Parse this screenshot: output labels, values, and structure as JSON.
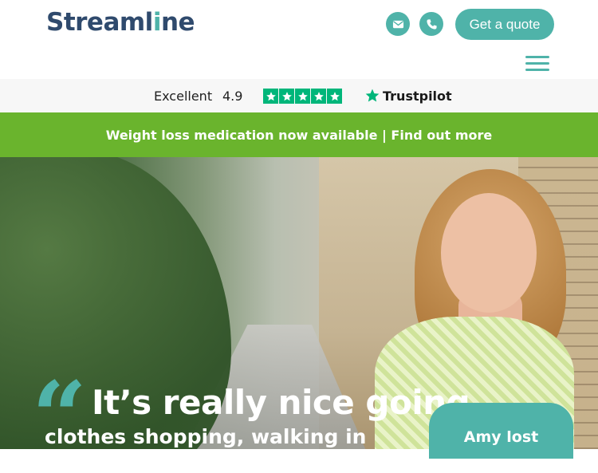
{
  "header": {
    "logo": {
      "before": "Streaml",
      "accent": "i",
      "after": "ne"
    },
    "email_icon": "envelope-icon",
    "phone_icon": "phone-icon",
    "quote_button": "Get a quote",
    "menu_icon": "hamburger-menu-icon"
  },
  "trust_bar": {
    "rating_label": "Excellent",
    "rating_value": "4.9",
    "stars": 5,
    "brand": "Trustpilot"
  },
  "promo": {
    "text": "Weight loss medication now available | Find out more"
  },
  "hero": {
    "quote_line1": "It’s really nice going",
    "quote_line2": "clothes shopping, walking in",
    "result_card": "Amy lost"
  },
  "colors": {
    "brand_teal": "#4fb3a9",
    "brand_navy": "#2f4a6d",
    "promo_green": "#6ab42d",
    "trustpilot_green": "#00b67a"
  }
}
